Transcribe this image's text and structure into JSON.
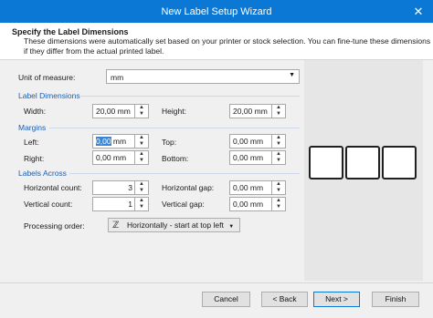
{
  "window": {
    "title": "New Label Setup Wizard",
    "close_icon": "close-icon"
  },
  "header": {
    "title": "Specify the Label Dimensions",
    "description": "These dimensions were automatically set based on your printer or stock selection. You can fine-tune these dimensions if they differ from the actual printed label."
  },
  "unit": {
    "label": "Unit of measure:",
    "value": "mm"
  },
  "label_dimensions": {
    "section": "Label Dimensions",
    "width_label": "Width:",
    "width_value": "20,00 mm",
    "height_label": "Height:",
    "height_value": "20,00 mm"
  },
  "margins": {
    "section": "Margins",
    "left_label": "Left:",
    "left_value_selected": "0,00",
    "left_value_rest": " mm",
    "top_label": "Top:",
    "top_value": "0,00 mm",
    "right_label": "Right:",
    "right_value": "0,00 mm",
    "bottom_label": "Bottom:",
    "bottom_value": "0,00 mm"
  },
  "labels_across": {
    "section": "Labels Across",
    "hcount_label": "Horizontal count:",
    "hcount_value": "3",
    "hgap_label": "Horizontal gap:",
    "hgap_value": "0,00 mm",
    "vcount_label": "Vertical count:",
    "vcount_value": "1",
    "vgap_label": "Vertical gap:",
    "vgap_value": "0,00 mm"
  },
  "processing": {
    "label": "Processing order:",
    "value": "Horizontally - start at top left"
  },
  "preview": {
    "label_count": 3
  },
  "footer": {
    "cancel": "Cancel",
    "back": "< Back",
    "next": "Next >",
    "finish": "Finish"
  }
}
